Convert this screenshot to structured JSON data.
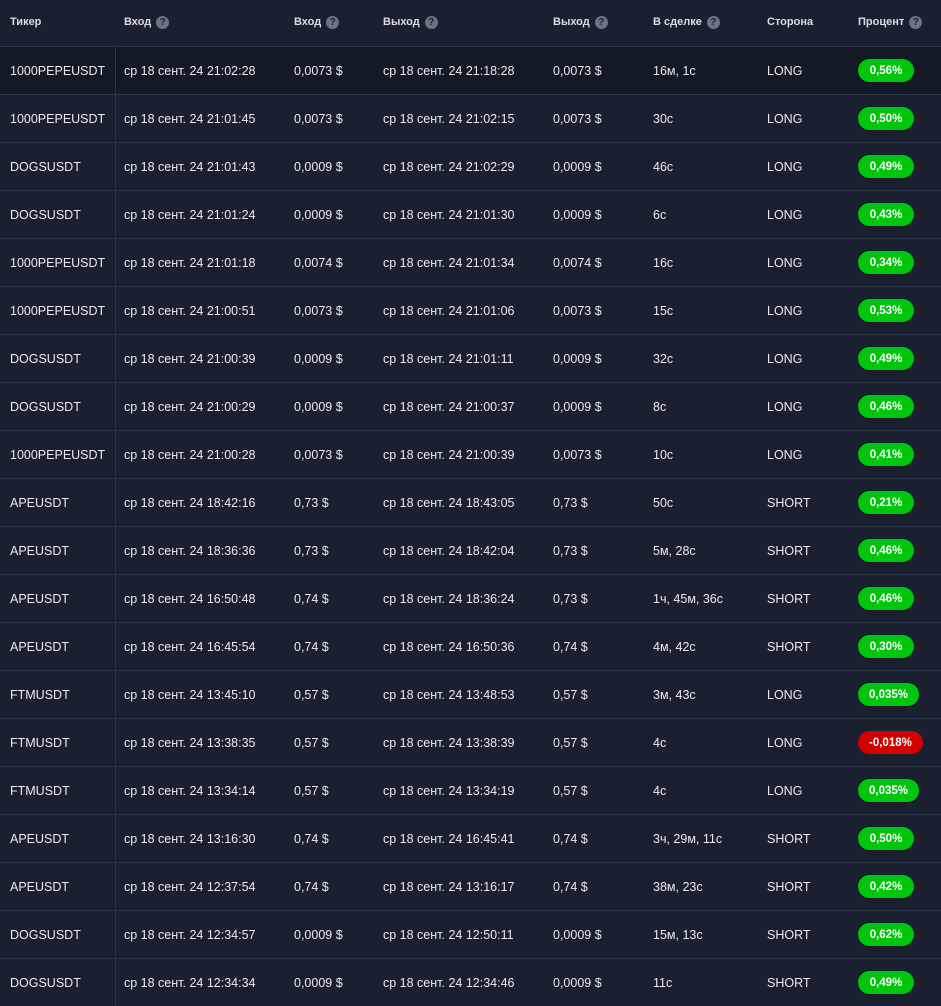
{
  "colors": {
    "background": "#1a2030",
    "positive": "#00c50d",
    "negative": "#d40000"
  },
  "headers": [
    {
      "label": "Тикер",
      "help": false
    },
    {
      "label": "Вход",
      "help": true
    },
    {
      "label": "Вход",
      "help": true
    },
    {
      "label": "Выход",
      "help": true
    },
    {
      "label": "Выход",
      "help": true
    },
    {
      "label": "В сделке",
      "help": true
    },
    {
      "label": "Сторона",
      "help": false
    },
    {
      "label": "Процент",
      "help": true
    }
  ],
  "help_glyph": "?",
  "rows": [
    {
      "ticker": "1000PEPEUSDT",
      "entry_time": "ср 18 сент. 24 21:02:28",
      "entry_price": "0,0073 $",
      "exit_time": "ср 18 сент. 24 21:18:28",
      "exit_price": "0,0073 $",
      "duration": "16м, 1с",
      "side": "LONG",
      "percent": "0,56%",
      "positive": true
    },
    {
      "ticker": "1000PEPEUSDT",
      "entry_time": "ср 18 сент. 24 21:01:45",
      "entry_price": "0,0073 $",
      "exit_time": "ср 18 сент. 24 21:02:15",
      "exit_price": "0,0073 $",
      "duration": "30с",
      "side": "LONG",
      "percent": "0,50%",
      "positive": true
    },
    {
      "ticker": "DOGSUSDT",
      "entry_time": "ср 18 сент. 24 21:01:43",
      "entry_price": "0,0009 $",
      "exit_time": "ср 18 сент. 24 21:02:29",
      "exit_price": "0,0009 $",
      "duration": "46с",
      "side": "LONG",
      "percent": "0,49%",
      "positive": true
    },
    {
      "ticker": "DOGSUSDT",
      "entry_time": "ср 18 сент. 24 21:01:24",
      "entry_price": "0,0009 $",
      "exit_time": "ср 18 сент. 24 21:01:30",
      "exit_price": "0,0009 $",
      "duration": "6с",
      "side": "LONG",
      "percent": "0,43%",
      "positive": true
    },
    {
      "ticker": "1000PEPEUSDT",
      "entry_time": "ср 18 сент. 24 21:01:18",
      "entry_price": "0,0074 $",
      "exit_time": "ср 18 сент. 24 21:01:34",
      "exit_price": "0,0074 $",
      "duration": "16с",
      "side": "LONG",
      "percent": "0,34%",
      "positive": true
    },
    {
      "ticker": "1000PEPEUSDT",
      "entry_time": "ср 18 сент. 24 21:00:51",
      "entry_price": "0,0073 $",
      "exit_time": "ср 18 сент. 24 21:01:06",
      "exit_price": "0,0073 $",
      "duration": "15с",
      "side": "LONG",
      "percent": "0,53%",
      "positive": true
    },
    {
      "ticker": "DOGSUSDT",
      "entry_time": "ср 18 сент. 24 21:00:39",
      "entry_price": "0,0009 $",
      "exit_time": "ср 18 сент. 24 21:01:11",
      "exit_price": "0,0009 $",
      "duration": "32с",
      "side": "LONG",
      "percent": "0,49%",
      "positive": true
    },
    {
      "ticker": "DOGSUSDT",
      "entry_time": "ср 18 сент. 24 21:00:29",
      "entry_price": "0,0009 $",
      "exit_time": "ср 18 сент. 24 21:00:37",
      "exit_price": "0,0009 $",
      "duration": "8с",
      "side": "LONG",
      "percent": "0,46%",
      "positive": true
    },
    {
      "ticker": "1000PEPEUSDT",
      "entry_time": "ср 18 сент. 24 21:00:28",
      "entry_price": "0,0073 $",
      "exit_time": "ср 18 сент. 24 21:00:39",
      "exit_price": "0,0073 $",
      "duration": "10с",
      "side": "LONG",
      "percent": "0,41%",
      "positive": true
    },
    {
      "ticker": "APEUSDT",
      "entry_time": "ср 18 сент. 24 18:42:16",
      "entry_price": "0,73 $",
      "exit_time": "ср 18 сент. 24 18:43:05",
      "exit_price": "0,73 $",
      "duration": "50с",
      "side": "SHORT",
      "percent": "0,21%",
      "positive": true
    },
    {
      "ticker": "APEUSDT",
      "entry_time": "ср 18 сент. 24 18:36:36",
      "entry_price": "0,73 $",
      "exit_time": "ср 18 сент. 24 18:42:04",
      "exit_price": "0,73 $",
      "duration": "5м, 28с",
      "side": "SHORT",
      "percent": "0,46%",
      "positive": true
    },
    {
      "ticker": "APEUSDT",
      "entry_time": "ср 18 сент. 24 16:50:48",
      "entry_price": "0,74 $",
      "exit_time": "ср 18 сент. 24 18:36:24",
      "exit_price": "0,73 $",
      "duration": "1ч, 45м, 36с",
      "side": "SHORT",
      "percent": "0,46%",
      "positive": true
    },
    {
      "ticker": "APEUSDT",
      "entry_time": "ср 18 сент. 24 16:45:54",
      "entry_price": "0,74 $",
      "exit_time": "ср 18 сент. 24 16:50:36",
      "exit_price": "0,74 $",
      "duration": "4м, 42с",
      "side": "SHORT",
      "percent": "0,30%",
      "positive": true
    },
    {
      "ticker": "FTMUSDT",
      "entry_time": "ср 18 сент. 24 13:45:10",
      "entry_price": "0,57 $",
      "exit_time": "ср 18 сент. 24 13:48:53",
      "exit_price": "0,57 $",
      "duration": "3м, 43с",
      "side": "LONG",
      "percent": "0,035%",
      "positive": true
    },
    {
      "ticker": "FTMUSDT",
      "entry_time": "ср 18 сент. 24 13:38:35",
      "entry_price": "0,57 $",
      "exit_time": "ср 18 сент. 24 13:38:39",
      "exit_price": "0,57 $",
      "duration": "4с",
      "side": "LONG",
      "percent": "-0,018%",
      "positive": false
    },
    {
      "ticker": "FTMUSDT",
      "entry_time": "ср 18 сент. 24 13:34:14",
      "entry_price": "0,57 $",
      "exit_time": "ср 18 сент. 24 13:34:19",
      "exit_price": "0,57 $",
      "duration": "4с",
      "side": "LONG",
      "percent": "0,035%",
      "positive": true
    },
    {
      "ticker": "APEUSDT",
      "entry_time": "ср 18 сент. 24 13:16:30",
      "entry_price": "0,74 $",
      "exit_time": "ср 18 сент. 24 16:45:41",
      "exit_price": "0,74 $",
      "duration": "3ч, 29м, 11с",
      "side": "SHORT",
      "percent": "0,50%",
      "positive": true
    },
    {
      "ticker": "APEUSDT",
      "entry_time": "ср 18 сент. 24 12:37:54",
      "entry_price": "0,74 $",
      "exit_time": "ср 18 сент. 24 13:16:17",
      "exit_price": "0,74 $",
      "duration": "38м, 23с",
      "side": "SHORT",
      "percent": "0,42%",
      "positive": true
    },
    {
      "ticker": "DOGSUSDT",
      "entry_time": "ср 18 сент. 24 12:34:57",
      "entry_price": "0,0009 $",
      "exit_time": "ср 18 сент. 24 12:50:11",
      "exit_price": "0,0009 $",
      "duration": "15м, 13с",
      "side": "SHORT",
      "percent": "0,62%",
      "positive": true
    },
    {
      "ticker": "DOGSUSDT",
      "entry_time": "ср 18 сент. 24 12:34:34",
      "entry_price": "0,0009 $",
      "exit_time": "ср 18 сент. 24 12:34:46",
      "exit_price": "0,0009 $",
      "duration": "11с",
      "side": "SHORT",
      "percent": "0,49%",
      "positive": true
    }
  ]
}
